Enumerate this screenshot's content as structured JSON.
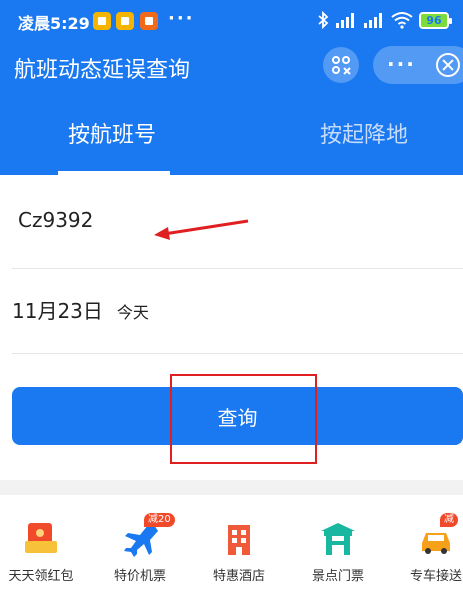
{
  "status_bar": {
    "time": "凌晨5:29",
    "more": "···",
    "battery": "96"
  },
  "header": {
    "title": "航班动态延误查询",
    "menu_more": "···"
  },
  "tabs": [
    {
      "label": "按航班号",
      "active": true
    },
    {
      "label": "按起降地",
      "active": false
    }
  ],
  "form": {
    "flight_number": "Cz9392",
    "date": "11月23日",
    "date_hint": "今天",
    "query_label": "查询"
  },
  "services": [
    {
      "label": "天天领红包",
      "icon": "red-packet-icon"
    },
    {
      "label": "特价机票",
      "icon": "airplane-icon",
      "badge": "减20"
    },
    {
      "label": "特惠酒店",
      "icon": "hotel-icon"
    },
    {
      "label": "景点门票",
      "icon": "attraction-gate-icon"
    },
    {
      "label": "专车接送",
      "icon": "car-icon",
      "badge": "减"
    }
  ],
  "colors": {
    "brand_blue": "#1a78f0",
    "annotation_red": "#e02020"
  }
}
